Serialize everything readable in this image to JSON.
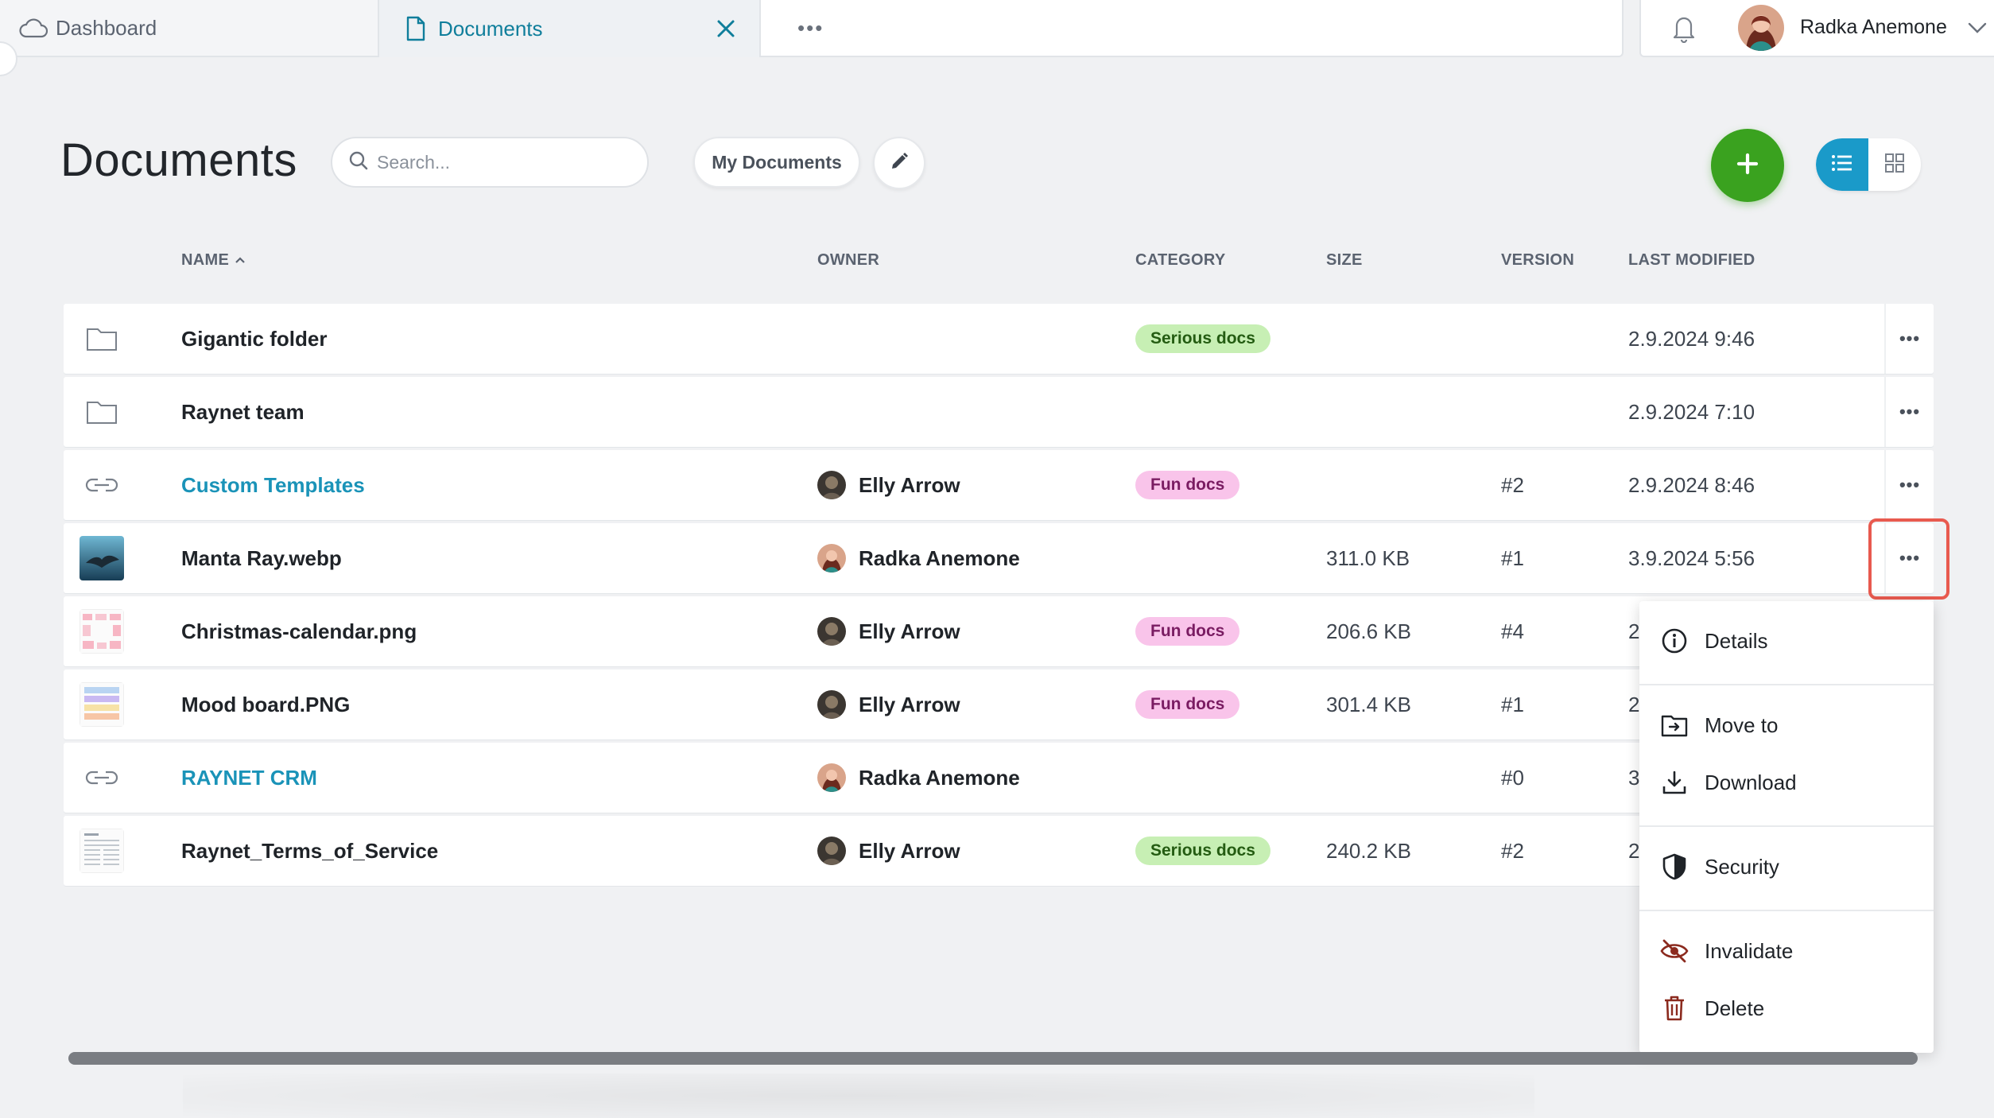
{
  "tabs": [
    {
      "label": "Dashboard",
      "icon": "cloud-icon"
    },
    {
      "label": "Documents",
      "icon": "document-icon"
    }
  ],
  "tab_more": "•••",
  "user": {
    "name": "Radka Anemone"
  },
  "page": {
    "title": "Documents",
    "search_placeholder": "Search...",
    "filter_label": "My Documents"
  },
  "columns": {
    "name": "NAME",
    "owner": "OWNER",
    "category": "CATEGORY",
    "size": "SIZE",
    "version": "VERSION",
    "modified": "LAST MODIFIED"
  },
  "rows": [
    {
      "icon": "folder-icon",
      "name": "Gigantic folder",
      "owner": "",
      "category": "Serious docs",
      "size": "",
      "version": "",
      "modified": "2.9.2024 9:46"
    },
    {
      "icon": "folder-icon",
      "name": "Raynet team",
      "owner": "",
      "category": "",
      "size": "",
      "version": "",
      "modified": "2.9.2024 7:10"
    },
    {
      "icon": "link-icon",
      "name": "Custom Templates",
      "owner": "Elly Arrow",
      "category": "Fun docs",
      "size": "",
      "version": "#2",
      "modified": "2.9.2024 8:46"
    },
    {
      "icon": "image-thumbnail",
      "name": "Manta Ray.webp",
      "owner": "Radka Anemone",
      "category": "",
      "size": "311.0 KB",
      "version": "#1",
      "modified": "3.9.2024 5:56"
    },
    {
      "icon": "calendar-thumbnail",
      "name": "Christmas-calendar.png",
      "owner": "Elly Arrow",
      "category": "Fun docs",
      "size": "206.6 KB",
      "version": "#4",
      "modified": "2"
    },
    {
      "icon": "moodboard-thumbnail",
      "name": "Mood board.PNG",
      "owner": "Elly Arrow",
      "category": "Fun docs",
      "size": "301.4 KB",
      "version": "#1",
      "modified": "2"
    },
    {
      "icon": "link-icon",
      "name": "RAYNET CRM",
      "owner": "Radka Anemone",
      "category": "",
      "size": "",
      "version": "#0",
      "modified": "3"
    },
    {
      "icon": "document-thumbnail",
      "name": "Raynet_Terms_of_Service",
      "owner": "Elly Arrow",
      "category": "Serious docs",
      "size": "240.2 KB",
      "version": "#2",
      "modified": "2"
    }
  ],
  "row_more": "•••",
  "context_menu": {
    "details": "Details",
    "move_to": "Move to",
    "download": "Download",
    "security": "Security",
    "invalidate": "Invalidate",
    "delete": "Delete"
  },
  "colors": {
    "accent": "#1a93b8",
    "add_button": "#3aa21f",
    "highlight": "#e85a4f",
    "serious_badge": "#c7efb4",
    "fun_badge": "#f9c4ea"
  }
}
